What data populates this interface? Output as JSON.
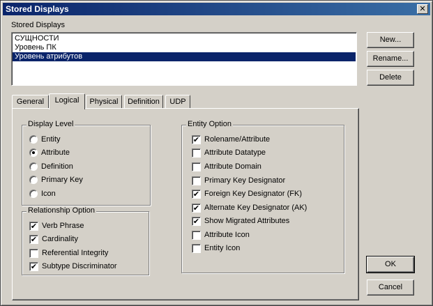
{
  "window": {
    "title": "Stored Displays",
    "close_glyph": "✕"
  },
  "stored_displays": {
    "label": "Stored Displays",
    "items": [
      "СУЩНОСТИ",
      "Уровень ПК",
      "Уровень атрибутов"
    ],
    "selected_index": 2
  },
  "buttons": {
    "new": "New...",
    "rename": "Rename...",
    "delete": "Delete",
    "ok": "OK",
    "cancel": "Cancel"
  },
  "tabs": [
    "General",
    "Logical",
    "Physical",
    "Definition",
    "UDP"
  ],
  "active_tab": "Logical",
  "display_level": {
    "title": "Display Level",
    "options": [
      {
        "label": "Entity",
        "selected": false
      },
      {
        "label": "Attribute",
        "selected": true
      },
      {
        "label": "Definition",
        "selected": false
      },
      {
        "label": "Primary Key",
        "selected": false
      },
      {
        "label": "Icon",
        "selected": false
      }
    ]
  },
  "relationship_option": {
    "title": "Relationship Option",
    "options": [
      {
        "label": "Verb Phrase",
        "checked": true
      },
      {
        "label": "Cardinality",
        "checked": true
      },
      {
        "label": "Referential Integrity",
        "checked": false
      },
      {
        "label": "Subtype Discriminator",
        "checked": true
      }
    ]
  },
  "entity_option": {
    "title": "Entity Option",
    "options": [
      {
        "label": "Rolename/Attribute",
        "checked": true
      },
      {
        "label": "Attribute Datatype",
        "checked": false
      },
      {
        "label": "Attribute Domain",
        "checked": false
      },
      {
        "label": "Primary Key Designator",
        "checked": false
      },
      {
        "label": "Foreign Key Designator (FK)",
        "checked": true
      },
      {
        "label": "Alternate Key Designator (AK)",
        "checked": true
      },
      {
        "label": "Show Migrated Attributes",
        "checked": true
      },
      {
        "label": "Attribute Icon",
        "checked": false
      },
      {
        "label": "Entity Icon",
        "checked": false
      }
    ]
  }
}
